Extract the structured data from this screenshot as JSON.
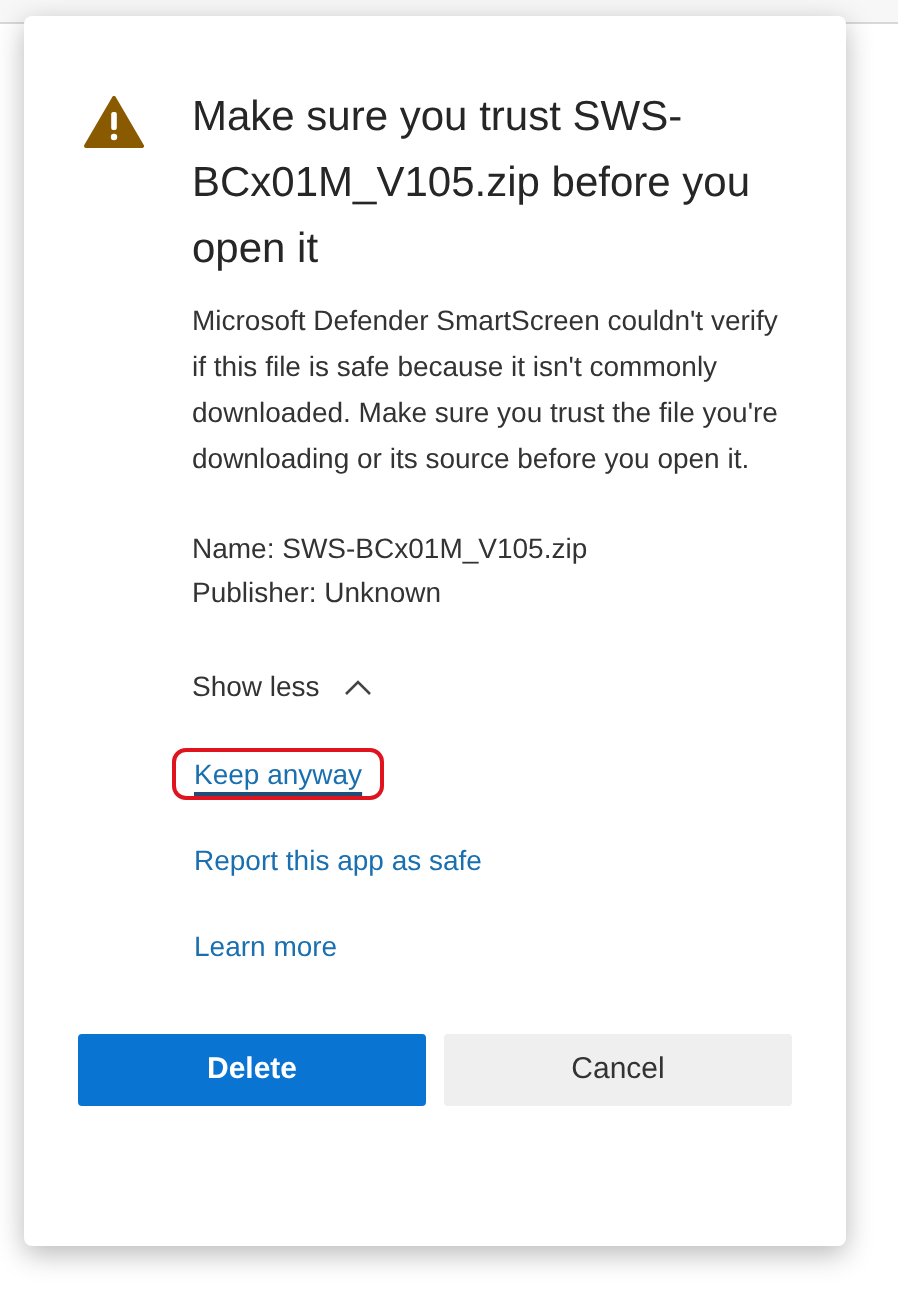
{
  "dialog": {
    "title": "Make sure you trust SWS-BCx01M_V105.zip before you open it",
    "message": "Microsoft Defender SmartScreen couldn't verify if this file is safe because it isn't commonly downloaded. Make sure you trust the file you're downloading or its source before you open it.",
    "details": [
      "Name: SWS-BCx01M_V105.zip",
      "Publisher: Unknown"
    ],
    "toggle": {
      "label": "Show less",
      "expanded": true
    },
    "links": [
      {
        "label": "Keep anyway",
        "highlighted": true
      },
      {
        "label": "Report this app as safe",
        "highlighted": false
      },
      {
        "label": "Learn more",
        "highlighted": false
      }
    ],
    "buttons": [
      {
        "label": "Delete",
        "kind": "primary"
      },
      {
        "label": "Cancel",
        "kind": "secondary"
      }
    ]
  }
}
